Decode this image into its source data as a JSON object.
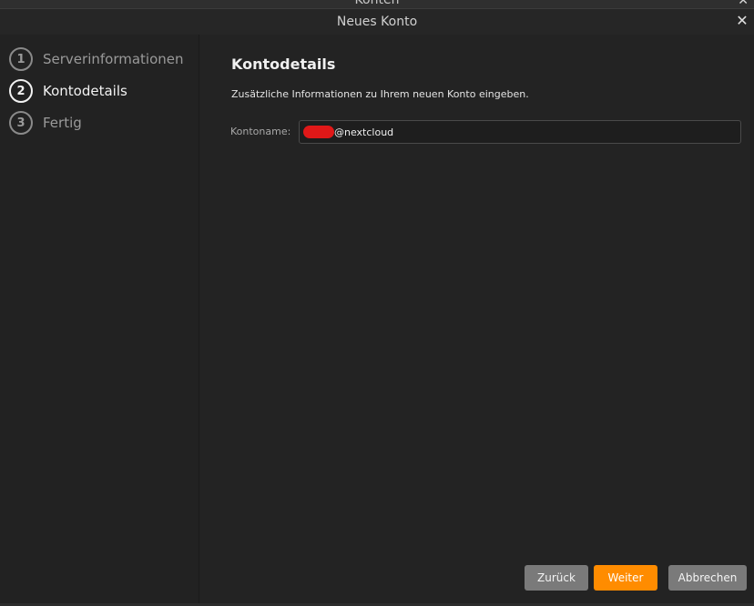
{
  "background_window": {
    "title": "Konten",
    "close_glyph": "✕"
  },
  "dialog": {
    "title": "Neues Konto",
    "close_glyph": "✕"
  },
  "steps": [
    {
      "number": "1",
      "label": "Serverinformationen",
      "state": "done"
    },
    {
      "number": "2",
      "label": "Kontodetails",
      "state": "active"
    },
    {
      "number": "3",
      "label": "Fertig",
      "state": "pending"
    }
  ],
  "page": {
    "heading": "Kontodetails",
    "description": "Zusätzliche Informationen zu Ihrem neuen Konto eingeben.",
    "account_name_label": "Kontoname:",
    "account_name_value": "@nextcloud"
  },
  "buttons": {
    "back": "Zurück",
    "next": "Weiter",
    "cancel": "Abbrechen"
  },
  "colors": {
    "accent": "#ff8c00",
    "button_gray": "#7a7a7a",
    "redaction": "#e01818",
    "background": "#222222"
  },
  "icons": {
    "close": "close-icon"
  }
}
